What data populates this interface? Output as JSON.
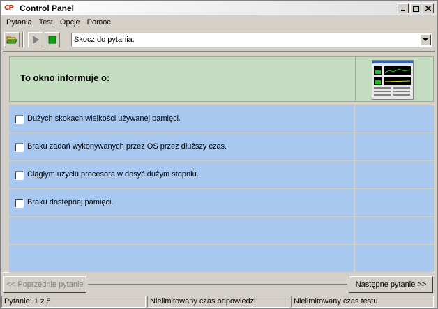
{
  "window": {
    "title": "Control Panel",
    "logo_text": "CP"
  },
  "menu": [
    "Pytania",
    "Test",
    "Opcje",
    "Pomoc"
  ],
  "toolbar": {
    "jump_placeholder": "Skocz do pytania:"
  },
  "question": {
    "text": "To okno informuje o:"
  },
  "answers": [
    {
      "text": "Dużych skokach wielkości używanej pamięci.",
      "checked": false
    },
    {
      "text": "Braku zadań wykonywanych przez OS przez dłuższy czas.",
      "checked": false
    },
    {
      "text": "Ciągłym użyciu procesora w dosyć dużym stopniu.",
      "checked": false
    },
    {
      "text": "Braku dostępnej pamięci.",
      "checked": false
    }
  ],
  "nav": {
    "prev": "<< Poprzednie pytanie",
    "next": "Następne pytanie >>"
  },
  "status": {
    "question": "Pytanie: 1 z 8",
    "answer_time": "Nielimitowany czas odpowiedzi",
    "test_time": "Nielimitowany czas testu"
  },
  "colors": {
    "question_bg": "#c4dcc0",
    "answer_bg": "#a8c8f0",
    "chrome": "#d4d0c8"
  },
  "icons": [
    "open-folder-icon",
    "play-icon",
    "stop-icon",
    "dropdown-arrow-icon",
    "minimize-icon",
    "maximize-icon",
    "close-icon"
  ]
}
